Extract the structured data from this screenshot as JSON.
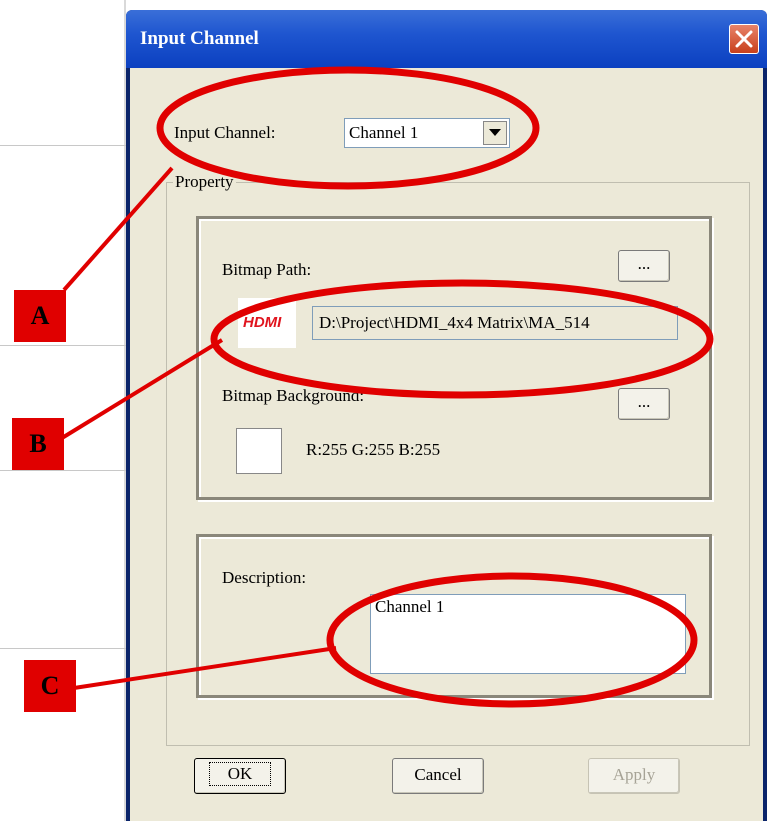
{
  "window": {
    "title": "Input Channel"
  },
  "input_channel": {
    "label": "Input Channel:",
    "selected": "Channel 1"
  },
  "property": {
    "group_label": "Property",
    "bitmap_path_label": "Bitmap Path:",
    "browse_label": "...",
    "path_value": "D:\\Project\\HDMI_4x4 Matrix\\MA_514",
    "logo_text": "HDMI",
    "bitmap_background_label": "Bitmap Background:",
    "color_browse_label": "...",
    "rgb_text": "R:255  G:255  B:255",
    "swatch_color": "#ffffff"
  },
  "description": {
    "label": "Description:",
    "value": "Channel 1"
  },
  "buttons": {
    "ok": "OK",
    "cancel": "Cancel",
    "apply": "Apply"
  },
  "annotations": {
    "a": "A",
    "b": "B",
    "c": "C",
    "color": "#e00000"
  }
}
